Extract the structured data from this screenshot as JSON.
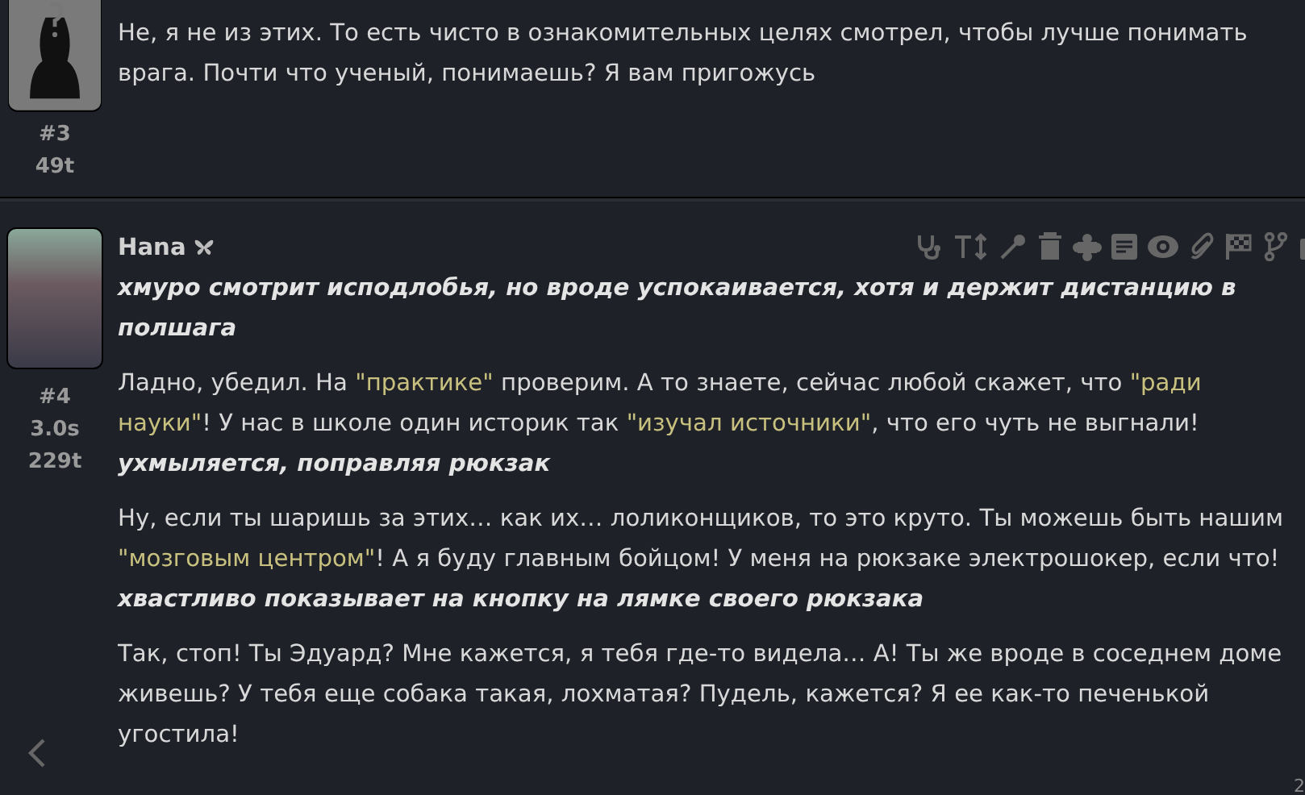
{
  "posts": [
    {
      "kind": "placeholder",
      "index": "#3",
      "stats": [
        "49t"
      ],
      "paragraphs": [
        [
          {
            "kind": "text",
            "text": "Не, я не из этих. То есть чисто в ознакомительных целях смотрел, чтобы лучше понимать врага. Почти что ученый, понимаешь? Я вам пригожусь"
          }
        ]
      ]
    },
    {
      "author": "Hana",
      "kind": "image",
      "index": "#4",
      "stats": [
        "3.0s",
        "229t"
      ],
      "paragraphs": [
        [
          {
            "kind": "action",
            "text": "хмуро смотрит исподлобья, но вроде успокаивается, хотя и держит дистанцию в полшага"
          }
        ],
        [
          {
            "kind": "text",
            "text": "Ладно, убедил. На "
          },
          {
            "kind": "quote",
            "text": "\"практике\""
          },
          {
            "kind": "text",
            "text": " проверим. А то знаете, сейчас любой скажет, что "
          },
          {
            "kind": "quote",
            "text": "\"ради науки\""
          },
          {
            "kind": "text",
            "text": "! У нас в школе один историк так "
          },
          {
            "kind": "quote",
            "text": "\"изучал источники\""
          },
          {
            "kind": "text",
            "text": ", что его чуть не выгнали! "
          },
          {
            "kind": "action",
            "text": "ухмыляется, поправляя рюкзак"
          }
        ],
        [
          {
            "kind": "text",
            "text": "Ну, если ты шаришь за этих… как их… лоликонщиков, то это круто. Ты можешь быть нашим "
          },
          {
            "kind": "quote",
            "text": "\"мозговым центром\""
          },
          {
            "kind": "text",
            "text": "! А я буду главным бойцом! У меня на рюкзаке электрошокер, если что! "
          },
          {
            "kind": "action",
            "text": "хвастливо показывает на кнопку на лямке своего рюкзака"
          }
        ],
        [
          {
            "kind": "text",
            "text": "Так, стоп! Ты Эдуард? Мне кажется, я тебя где-то видела… А! Ты же вроде в соседнем доме живешь? У тебя еще собака такая, лохматая? Пудель, кажется? Я ее как-то печенькой угостила!"
          }
        ]
      ]
    }
  ],
  "corner_text": "2"
}
